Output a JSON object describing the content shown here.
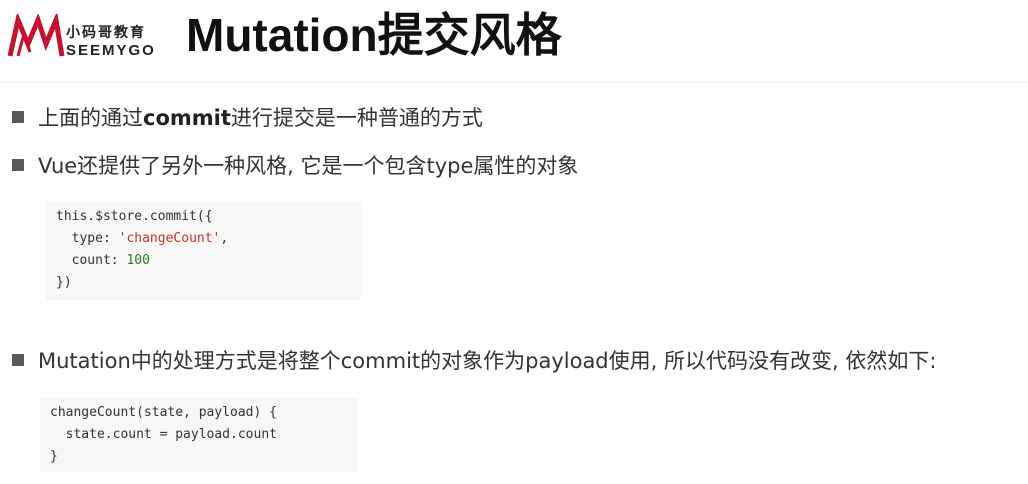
{
  "header": {
    "logo_cn": "小码哥教育",
    "logo_en": "SEEMYGO",
    "title": "Mutation提交风格"
  },
  "bullets": [
    {
      "pre": "上面的通过",
      "bold": "commit",
      "post": "进行提交是一种普通的方式"
    },
    {
      "text": "Vue还提供了另外一种风格, 它是一个包含type属性的对象"
    },
    {
      "text": "Mutation中的处理方式是将整个commit的对象作为payload使用, 所以代码没有改变, 依然如下:"
    }
  ],
  "code1": {
    "line1": "this.$store.commit({",
    "line2_key": "  type: ",
    "line2_str": "'changeCount'",
    "line2_end": ",",
    "line3_key": "  count: ",
    "line3_num": "100",
    "line4": "})"
  },
  "code2": {
    "line1": "changeCount(state, payload) {",
    "line2": "  state.count = payload.count",
    "line3": "}"
  },
  "colors": {
    "string": "#c0392b",
    "number": "#2a7a2a",
    "logo_red": "#c8102e"
  }
}
